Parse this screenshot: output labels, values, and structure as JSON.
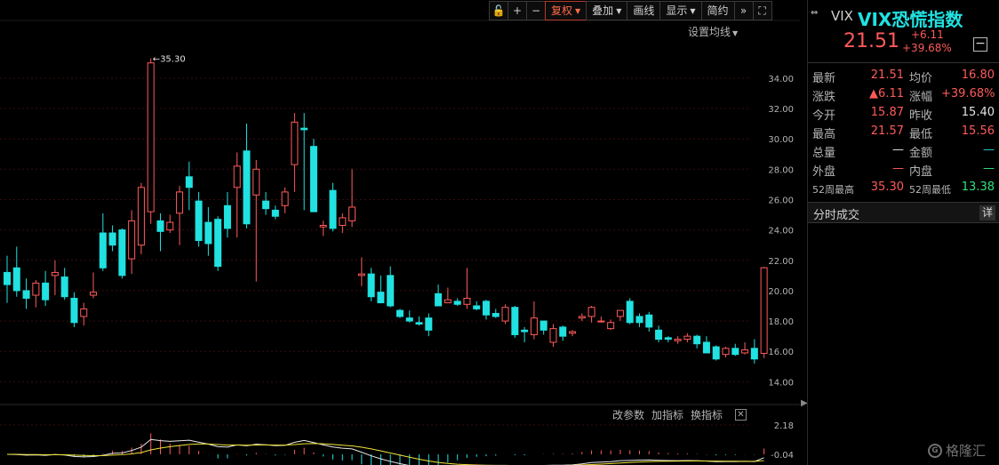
{
  "toolbar": {
    "items": [
      {
        "id": "lock",
        "label": "🔓",
        "icon": "lock-icon"
      },
      {
        "id": "zoom-in",
        "label": "+",
        "icon": "plus-icon"
      },
      {
        "id": "zoom-out",
        "label": "−",
        "icon": "minus-icon"
      },
      {
        "id": "restore",
        "label": "复权",
        "caret": true,
        "active": true
      },
      {
        "id": "overlay",
        "label": "叠加",
        "caret": true
      },
      {
        "id": "draw",
        "label": "画线"
      },
      {
        "id": "display",
        "label": "显示",
        "caret": true
      },
      {
        "id": "simple",
        "label": "简约"
      },
      {
        "id": "expand",
        "label": "»",
        "icon": "double-arrow-icon"
      },
      {
        "id": "fullscreen",
        "label": "⛶",
        "icon": "fullscreen-icon"
      }
    ],
    "ma_setting": "设置均线"
  },
  "indicator_bar": {
    "change_params": "改参数",
    "add_indicator": "加指标",
    "switch_indicator": "换指标",
    "close": "✕"
  },
  "panel": {
    "link_icon": "⇔",
    "code": "VIX",
    "name": "VIX恐慌指数",
    "price": "21.51",
    "change": "+6.11",
    "change_pct": "+39.68%",
    "collapse": "−",
    "rows": [
      {
        "l1": "最新",
        "v1": "21.51",
        "c1": "red",
        "l2": "均价",
        "v2": "16.80",
        "c2": "red"
      },
      {
        "l1": "涨跌",
        "v1": "▲6.11",
        "c1": "red",
        "l2": "涨幅",
        "v2": "+39.68%",
        "c2": "red"
      },
      {
        "l1": "今开",
        "v1": "15.87",
        "c1": "red",
        "l2": "昨收",
        "v2": "15.40",
        "c2": "wht"
      },
      {
        "l1": "最高",
        "v1": "21.57",
        "c1": "red",
        "l2": "最低",
        "v2": "15.56",
        "c2": "red"
      },
      {
        "l1": "总量",
        "v1": "—",
        "c1": "wht",
        "l2": "金额",
        "v2": "—",
        "c2": "dashc"
      },
      {
        "l1": "外盘",
        "v1": "—",
        "c1": "dashr",
        "l2": "内盘",
        "v2": "—",
        "c2": "dashg"
      },
      {
        "l1": "52周最高",
        "v1": "35.30",
        "c1": "red",
        "l2": "52周最低",
        "v2": "13.38",
        "c2": "grn",
        "small": true
      }
    ],
    "fs_title": "分时成交",
    "fs_detail": "详",
    "watermark": "格隆汇",
    "watermark_badge": "G"
  },
  "colors": {
    "up": "#ff5a5a",
    "down": "#21e1e1",
    "ma_white": "#e8e8e8",
    "ma_yellow": "#f0e43a",
    "grid": "#3a0d0d"
  },
  "chart_data": {
    "type": "candlestick",
    "y_ticks": [
      "34.00",
      "32.00",
      "30.00",
      "28.00",
      "26.00",
      "24.00",
      "22.00",
      "20.00",
      "18.00",
      "16.00",
      "14.00"
    ],
    "ylim": [
      12.5,
      36.8
    ],
    "max_annotation": "←35.30",
    "candles": [
      {
        "o": 21.2,
        "h": 22.3,
        "l": 19.2,
        "c": 20.4
      },
      {
        "o": 21.5,
        "h": 22.9,
        "l": 19.6,
        "c": 20.0
      },
      {
        "o": 20.0,
        "h": 20.8,
        "l": 18.8,
        "c": 19.5
      },
      {
        "o": 19.7,
        "h": 20.7,
        "l": 18.9,
        "c": 20.5
      },
      {
        "o": 20.5,
        "h": 21.3,
        "l": 19.0,
        "c": 19.4
      },
      {
        "o": 21.0,
        "h": 22.0,
        "l": 19.7,
        "c": 21.2
      },
      {
        "o": 20.9,
        "h": 21.5,
        "l": 19.4,
        "c": 19.6
      },
      {
        "o": 19.5,
        "h": 19.9,
        "l": 17.6,
        "c": 17.9
      },
      {
        "o": 18.3,
        "h": 19.2,
        "l": 17.7,
        "c": 18.8
      },
      {
        "o": 19.7,
        "h": 21.2,
        "l": 19.5,
        "c": 19.9
      },
      {
        "o": 23.8,
        "h": 25.1,
        "l": 21.3,
        "c": 21.5
      },
      {
        "o": 23.8,
        "h": 24.3,
        "l": 22.6,
        "c": 23.0
      },
      {
        "o": 24.0,
        "h": 24.1,
        "l": 20.8,
        "c": 21.0
      },
      {
        "o": 22.1,
        "h": 25.3,
        "l": 21.1,
        "c": 24.6
      },
      {
        "o": 23.0,
        "h": 27.1,
        "l": 22.4,
        "c": 26.8
      },
      {
        "o": 25.2,
        "h": 35.3,
        "l": 24.4,
        "c": 35.0
      },
      {
        "o": 24.6,
        "h": 25.1,
        "l": 22.6,
        "c": 23.9
      },
      {
        "o": 24.0,
        "h": 25.0,
        "l": 23.8,
        "c": 24.5
      },
      {
        "o": 25.1,
        "h": 26.9,
        "l": 23.0,
        "c": 26.5
      },
      {
        "o": 27.5,
        "h": 28.5,
        "l": 25.3,
        "c": 26.8
      },
      {
        "o": 25.9,
        "h": 26.5,
        "l": 22.9,
        "c": 23.3
      },
      {
        "o": 24.5,
        "h": 25.5,
        "l": 22.3,
        "c": 23.1
      },
      {
        "o": 24.7,
        "h": 24.9,
        "l": 21.3,
        "c": 21.6
      },
      {
        "o": 25.6,
        "h": 26.5,
        "l": 23.5,
        "c": 24.1
      },
      {
        "o": 26.8,
        "h": 29.1,
        "l": 23.5,
        "c": 28.2
      },
      {
        "o": 29.2,
        "h": 31.0,
        "l": 24.1,
        "c": 24.4
      },
      {
        "o": 26.3,
        "h": 28.6,
        "l": 20.6,
        "c": 28.0
      },
      {
        "o": 25.9,
        "h": 26.5,
        "l": 25.0,
        "c": 25.4
      },
      {
        "o": 25.3,
        "h": 25.6,
        "l": 24.7,
        "c": 24.9
      },
      {
        "o": 25.6,
        "h": 26.8,
        "l": 25.1,
        "c": 26.5
      },
      {
        "o": 28.3,
        "h": 31.7,
        "l": 26.5,
        "c": 31.1
      },
      {
        "o": 30.7,
        "h": 31.7,
        "l": 25.3,
        "c": 30.6
      },
      {
        "o": 29.5,
        "h": 30.0,
        "l": 25.2,
        "c": 25.2
      },
      {
        "o": 24.2,
        "h": 24.6,
        "l": 23.6,
        "c": 24.3
      },
      {
        "o": 26.6,
        "h": 27.1,
        "l": 23.9,
        "c": 24.1
      },
      {
        "o": 24.3,
        "h": 25.1,
        "l": 23.8,
        "c": 24.8
      },
      {
        "o": 24.6,
        "h": 28.0,
        "l": 24.2,
        "c": 25.5
      },
      {
        "o": 21.0,
        "h": 22.2,
        "l": 20.3,
        "c": 21.1
      },
      {
        "o": 21.1,
        "h": 21.5,
        "l": 19.3,
        "c": 19.6
      },
      {
        "o": 19.9,
        "h": 21.0,
        "l": 19.4,
        "c": 19.2
      },
      {
        "o": 21.0,
        "h": 21.6,
        "l": 18.9,
        "c": 19.0
      },
      {
        "o": 18.7,
        "h": 18.8,
        "l": 18.2,
        "c": 18.3
      },
      {
        "o": 18.2,
        "h": 18.7,
        "l": 17.9,
        "c": 18.0
      },
      {
        "o": 17.9,
        "h": 18.3,
        "l": 17.7,
        "c": 17.8
      },
      {
        "o": 18.2,
        "h": 18.5,
        "l": 17.0,
        "c": 17.4
      },
      {
        "o": 19.8,
        "h": 20.4,
        "l": 19.0,
        "c": 19.0
      },
      {
        "o": 19.2,
        "h": 20.2,
        "l": 19.2,
        "c": 19.4
      },
      {
        "o": 19.3,
        "h": 19.5,
        "l": 19.0,
        "c": 19.1
      },
      {
        "o": 19.1,
        "h": 21.5,
        "l": 18.8,
        "c": 19.5
      },
      {
        "o": 19.0,
        "h": 19.3,
        "l": 18.7,
        "c": 18.8
      },
      {
        "o": 19.3,
        "h": 19.4,
        "l": 18.1,
        "c": 18.4
      },
      {
        "o": 18.5,
        "h": 18.8,
        "l": 18.2,
        "c": 18.3
      },
      {
        "o": 18.0,
        "h": 19.1,
        "l": 17.8,
        "c": 18.9
      },
      {
        "o": 18.9,
        "h": 19.0,
        "l": 16.9,
        "c": 17.1
      },
      {
        "o": 17.4,
        "h": 17.6,
        "l": 16.6,
        "c": 17.3
      },
      {
        "o": 17.1,
        "h": 19.3,
        "l": 16.8,
        "c": 18.2
      },
      {
        "o": 18.0,
        "h": 18.0,
        "l": 17.1,
        "c": 17.4
      },
      {
        "o": 16.6,
        "h": 17.8,
        "l": 16.3,
        "c": 17.5
      },
      {
        "o": 17.6,
        "h": 17.7,
        "l": 16.7,
        "c": 17.0
      },
      {
        "o": 17.2,
        "h": 17.4,
        "l": 17.0,
        "c": 17.3
      },
      {
        "o": 18.2,
        "h": 18.5,
        "l": 18.0,
        "c": 18.3
      },
      {
        "o": 18.3,
        "h": 19.0,
        "l": 17.9,
        "c": 18.9
      },
      {
        "o": 18.0,
        "h": 18.3,
        "l": 17.9,
        "c": 18.0
      },
      {
        "o": 17.5,
        "h": 18.1,
        "l": 17.4,
        "c": 17.9
      },
      {
        "o": 18.3,
        "h": 18.4,
        "l": 18.0,
        "c": 18.7
      },
      {
        "o": 19.3,
        "h": 19.5,
        "l": 17.8,
        "c": 17.9
      },
      {
        "o": 18.3,
        "h": 18.5,
        "l": 17.6,
        "c": 17.9
      },
      {
        "o": 18.4,
        "h": 18.6,
        "l": 17.3,
        "c": 17.6
      },
      {
        "o": 17.4,
        "h": 17.7,
        "l": 16.6,
        "c": 16.8
      },
      {
        "o": 16.9,
        "h": 17.0,
        "l": 16.6,
        "c": 16.8
      },
      {
        "o": 16.7,
        "h": 17.0,
        "l": 16.5,
        "c": 16.8
      },
      {
        "o": 16.8,
        "h": 17.2,
        "l": 16.6,
        "c": 17.0
      },
      {
        "o": 17.0,
        "h": 17.1,
        "l": 16.2,
        "c": 16.5
      },
      {
        "o": 16.6,
        "h": 17.0,
        "l": 15.9,
        "c": 15.9
      },
      {
        "o": 16.3,
        "h": 16.4,
        "l": 15.4,
        "c": 15.5
      },
      {
        "o": 15.8,
        "h": 16.3,
        "l": 15.6,
        "c": 16.2
      },
      {
        "o": 16.2,
        "h": 16.5,
        "l": 15.7,
        "c": 15.8
      },
      {
        "o": 15.9,
        "h": 16.6,
        "l": 15.8,
        "c": 16.1
      },
      {
        "o": 16.2,
        "h": 16.8,
        "l": 15.2,
        "c": 15.5
      },
      {
        "o": 15.87,
        "h": 21.57,
        "l": 15.56,
        "c": 21.51
      }
    ],
    "macd": {
      "y_ticks": [
        "2.18",
        "-0.04"
      ]
    }
  }
}
